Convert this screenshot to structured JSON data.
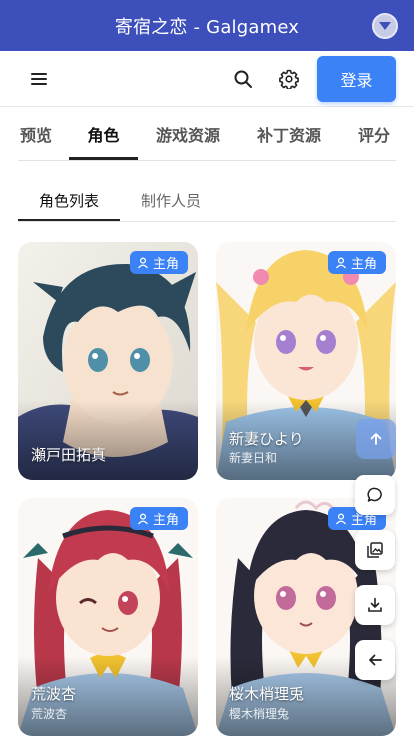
{
  "header": {
    "title": "寄宿之恋 - Galgamex"
  },
  "navbar": {
    "login_label": "登录",
    "icons": [
      "menu-icon",
      "search-icon",
      "gear-icon"
    ]
  },
  "tabs": [
    {
      "label": "预览",
      "active": false
    },
    {
      "label": "角色",
      "active": true
    },
    {
      "label": "游戏资源",
      "active": false
    },
    {
      "label": "补丁资源",
      "active": false
    },
    {
      "label": "评分",
      "active": false
    }
  ],
  "subtabs": [
    {
      "label": "角色列表",
      "active": true
    },
    {
      "label": "制作人员",
      "active": false
    }
  ],
  "characters": [
    {
      "badge": "主角",
      "name": "瀬戸田拓真",
      "subname": ""
    },
    {
      "badge": "主角",
      "name": "新妻ひより",
      "subname": "新妻日和"
    },
    {
      "badge": "主角",
      "name": "荒波杏",
      "subname": "荒波杏"
    },
    {
      "badge": "主角",
      "name": "桜木梢理兎",
      "subname": "樱木梢理兔"
    }
  ],
  "floating_actions": [
    "arrow-up-icon",
    "comment-icon",
    "image-gallery-icon",
    "download-icon",
    "arrow-left-icon"
  ],
  "colors": {
    "header_bg": "#3c4fba",
    "accent": "#3b82f6",
    "badge_bg": "#3b82f6"
  }
}
